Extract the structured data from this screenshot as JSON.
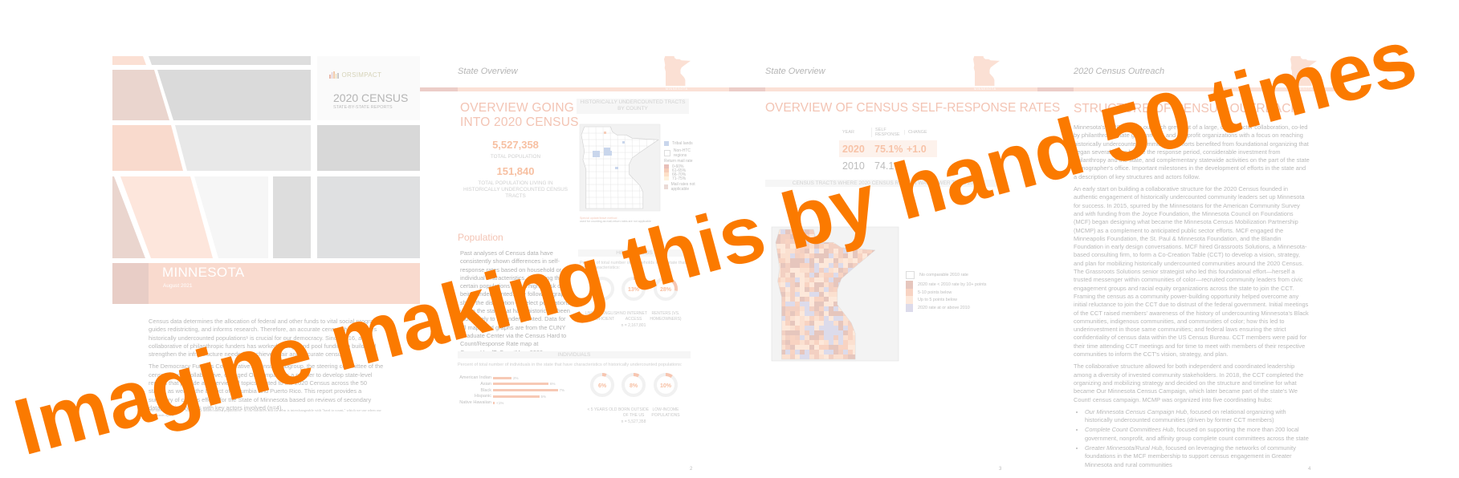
{
  "overlay_caption": "Imagine making this by hand 50 times",
  "colors": {
    "overlay_orange": "#fb7a00",
    "peach": "#f9d9cb",
    "rose": "#e8cdc6",
    "heading": "#f3c4b4",
    "tribal_blue": "#c9d6ec"
  },
  "cover": {
    "logo": "ORSIMPACT",
    "title": "2020 CENSUS",
    "subtitle": "STATE-BY-STATE REPORTS",
    "state": "MINNESOTA",
    "date": "August 2021",
    "paragraphs": [
      "Census data determines the allocation of federal and other funds to vital social programs, guides redistricting, and informs research. Therefore, an accurate census that captures historically undercounted populations¹ is crucial for our democracy. Since 2016, a collaborative of philanthropic funders has worked to align and pool funding to build and strengthen the infrastructure needed to achieve a fair and accurate census.",
      "The Democracy Funders Collaborative's Census Subgroup, the steering committee of the census funder collaborative, engaged ORS Impact as a partner to develop state-level reports that provide an overview of topics related to the 2020 Census across the 50 states, as well as the District of Columbia and Puerto Rico. This report provides a summary of census efforts for the State of Minnesota based on reviews of secondary data, and interviews with key actors involved (n=4)."
    ],
    "footnote": "¹We have chosen to use \"historically undercounted populations\" in our narrative, but the term is interchangeable with \"hard to count,\" which we use when our informants opted"
  },
  "page2": {
    "section": "State Overview",
    "state_label": "MINNESOTA",
    "title_line1": "OVERVIEW GOING",
    "title_line2": "INTO 2020 CENSUS",
    "total_population": "5,527,358",
    "total_population_label": "TOTAL POPULATION",
    "htc_population": "151,840",
    "htc_population_label": "TOTAL POPULATION LIVING IN HISTORICALLY UNDERCOUNTED CENSUS TRACTS",
    "map_title": "HISTORICALLY UNDERCOUNTED TRACTS BY COUNTY",
    "map_note_1": "Special update/leave method",
    "map_note_2": "used for counting as mail-return rates are not applicable",
    "legend": {
      "tribal": "Tribal lands",
      "non_htc": "Non-HTC regions",
      "rate_title": "Return mail rate",
      "rates": [
        {
          "label": "0-60%",
          "color": "#e8bfb8"
        },
        {
          "label": "61-65%",
          "color": "#f6cdb8"
        },
        {
          "label": "66-70%",
          "color": "#fde0c8"
        },
        {
          "label": "71-75%",
          "color": "#fff1dc"
        }
      ],
      "na": "Mail rates not applicable"
    },
    "population_heading": "Population",
    "population_text": "Past analyses of Census data have consistently shown differences in self-response rates based on household or individual characteristics, indicating that certain populations are at higher risk of being undercounted. The following graphs show the distribution of select populations within the state that have historically been more likely to be undercounted. Data for all maps and graphs are from the CUNY Graduate Center via the Census Hard to Count/Response Rate map at CensusHardToCountMaps2020.us.",
    "households_title": "HOUSEHOLDS",
    "households_caption": "Percent of total number of households in the state that have characteristics:",
    "households": [
      {
        "label": "LIMITED ENGLISH PROFICIENT",
        "value": null,
        "display": "",
        "n": ""
      },
      {
        "label": "NO INTERNET ACCESS",
        "value": 13,
        "display": "13%",
        "n": "n = 2,167,801"
      },
      {
        "label": "RENTERS (VS. HOMEOWNERS)",
        "value": 28,
        "display": "28%",
        "n": ""
      }
    ],
    "individuals_title": "INDIVIDUALS",
    "individuals_caption": "Percent of total number of individuals in the state that have characteristics of historically undercounted populations:",
    "race_bars": [
      {
        "label": "American Indian",
        "value": 2,
        "display": "2%"
      },
      {
        "label": "Asian",
        "value": 6,
        "display": "6%"
      },
      {
        "label": "Black",
        "value": 7,
        "display": "7%"
      },
      {
        "label": "Hispanic",
        "value": 5,
        "display": "5%"
      },
      {
        "label": "Native Hawaiian",
        "value": 0.2,
        "display": "<1%"
      }
    ],
    "individuals": [
      {
        "label": "< 5 YEARS OLD",
        "value": 6,
        "display": "6%",
        "n": ""
      },
      {
        "label": "BORN OUTSIDE OF THE US",
        "value": 8,
        "display": "8%",
        "n": "n = 5,527,358"
      },
      {
        "label": "LOW-INCOME POPULATIONS",
        "value": 10,
        "display": "10%",
        "n": ""
      }
    ],
    "page_number": "2"
  },
  "page3": {
    "section": "State Overview",
    "state_label": "MINNESOTA",
    "title": "OVERVIEW OF CENSUS SELF-RESPONSE RATES",
    "table": {
      "headers": [
        "YEAR",
        "SELF RESPONSE",
        "CHANGE"
      ],
      "rows": [
        {
          "year": "2020",
          "rate": "75.1%",
          "change": "+1.0"
        },
        {
          "year": "2010",
          "rate": "74.1%",
          "change": ""
        }
      ]
    },
    "map_title": "CENSUS TRACTS WHERE 2020 CENSUS RETURN WAS LOWER THAN 2010",
    "legend": [
      {
        "label": "No comparable 2010 rate",
        "color": "#ffffff"
      },
      {
        "label": "2020 rate < 2010 rate by 10+ points",
        "color": "#e6c6bd"
      },
      {
        "label": "5-10 points below",
        "color": "#f8d3c2"
      },
      {
        "label": "Up to 5 points below",
        "color": "#fde8da"
      },
      {
        "label": "2020 rate at or above 2010",
        "color": "#dcdbeb"
      }
    ],
    "page_number": "3"
  },
  "page4": {
    "section": "2020 Census Outreach",
    "state_label": "MINNESOTA",
    "title": "STRUCTURE OF CENSUS OUTREACH",
    "paragraphs": [
      "Minnesota's 2020 Census outreach grew out of a large, cross-sector collaboration, co-led by philanthropy, state government, and nonprofit organizations with a focus on reaching historically undercounted communities. Efforts benefited from foundational organizing that began several years before the response period, considerable investment from philanthropy and the state, and complementary statewide activities on the part of the state demographer's office. Important milestones in the development of efforts in the state and a description of key structures and actors follow.",
      "An early start on building a collaborative structure for the 2020 Census founded in authentic engagement of historically undercounted community leaders set up Minnesota for success. In 2015, spurred by the Minnesotans for the American Community Survey and with funding from the Joyce Foundation, the Minnesota Council on Foundations (MCF) began designing what became the Minnesota Census Mobilization Partnership (MCMP) as a complement to anticipated public sector efforts. MCF engaged the Minneapolis Foundation, the St. Paul & Minnesota Foundation, and the Blandin Foundation in early design conversations. MCF hired Grassroots Solutions, a Minnesota-based consulting firm, to form a Co-Creation Table (CCT) to develop a vision, strategy, and plan for mobilizing historically undercounted communities around the 2020 Census. The Grassroots Solutions senior strategist who led this foundational effort—herself a trusted messenger within communities of color—recruited community leaders from civic engagement groups and racial equity organizations across the state to join the CCT. Framing the census as a community power-building opportunity helped overcome any initial reluctance to join the CCT due to distrust of the federal government. Initial meetings of the CCT raised members' awareness of the history of undercounting Minnesota's Black communities, indigenous communities, and communities of color; how this led to underinvestment in those same communities; and federal laws ensuring the strict confidentiality of census data within the US Census Bureau. CCT members were paid for their time attending CCT meetings and for time to meet with members of their respective communities to inform the CCT's vision, strategy, and plan.",
      "The collaborative structure allowed for both independent and coordinated leadership among a diversity of invested community stakeholders. In 2018, the CCT completed the organizing and mobilizing strategy and decided on the structure and timeline for what became Our Minnesota Census Campaign, which later became part of the state's We Count! census campaign. MCMP was organized into five coordinating hubs:"
    ],
    "bullets": [
      {
        "name": "Our Minnesota Census Campaign Hub",
        "text": ", focused on relational organizing with historically undercounted communities (driven by former CCT members)"
      },
      {
        "name": "Complete Count Committees Hub",
        "text": ", focused on supporting the more than 200 local government, nonprofit, and affinity group complete count committees across the state"
      },
      {
        "name": "Greater Minnesota/Rural Hub",
        "text": ", focused on leveraging the networks of community foundations in the MCF membership to support census engagement in Greater Minnesota and rural communities"
      }
    ],
    "page_number": "4"
  }
}
